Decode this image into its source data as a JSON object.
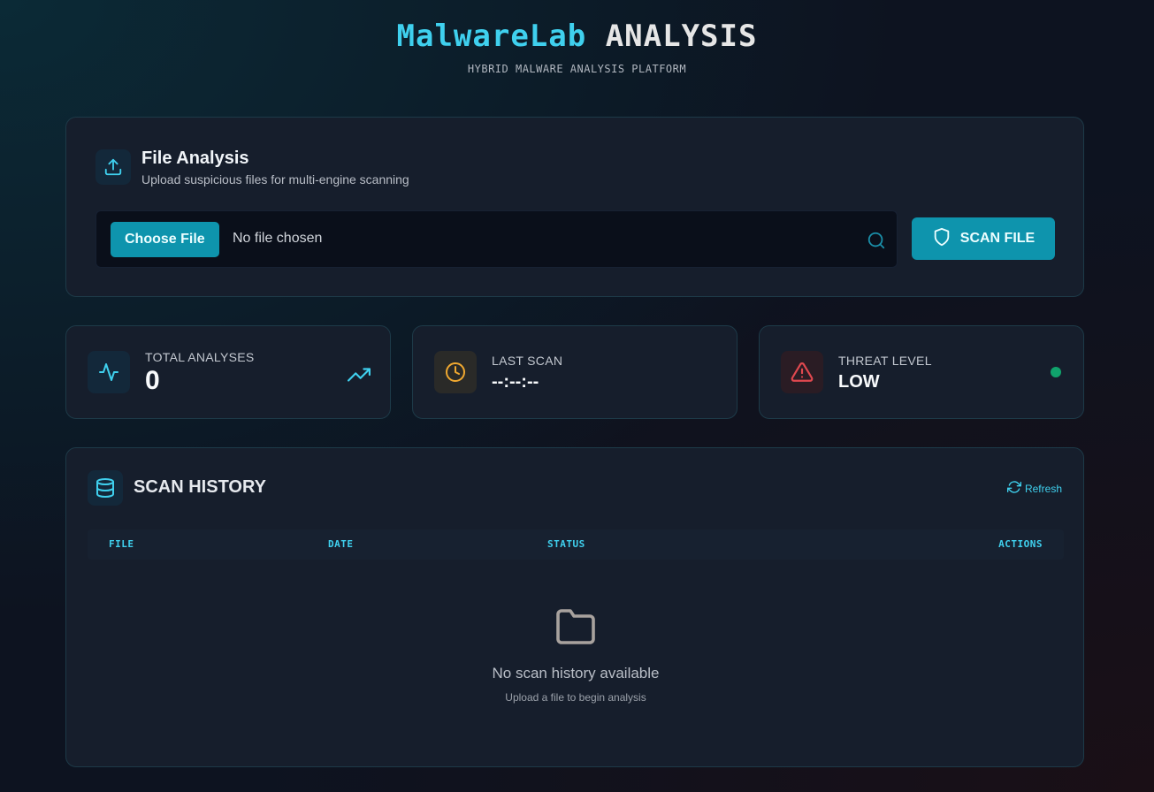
{
  "header": {
    "title_part1": "MalwareLab",
    "title_part2": "ANALYSIS",
    "subtitle": "HYBRID MALWARE ANALYSIS PLATFORM"
  },
  "upload": {
    "title": "File Analysis",
    "subtitle": "Upload suspicious files for multi-engine scanning",
    "choose_label": "Choose File",
    "file_status": "No file chosen",
    "scan_label": "SCAN FILE",
    "icon": "upload-icon"
  },
  "stats": {
    "total": {
      "label": "TOTAL ANALYSES",
      "value": "0",
      "icon": "activity-icon",
      "trend_icon": "trending-up-icon"
    },
    "last_scan": {
      "label": "LAST SCAN",
      "value": "--:--:--",
      "icon": "clock-icon"
    },
    "threat": {
      "label": "THREAT LEVEL",
      "value": "LOW",
      "icon": "alert-triangle-icon",
      "status_color": "#10a36c"
    }
  },
  "history": {
    "title": "SCAN HISTORY",
    "refresh_label": "Refresh",
    "columns": [
      "FILE",
      "DATE",
      "STATUS",
      "ACTIONS"
    ],
    "empty_title": "No scan history available",
    "empty_sub": "Upload a file to begin analysis",
    "icon": "database-icon"
  },
  "colors": {
    "accent": "#3fd0ee",
    "button": "#0e94ad",
    "warning": "#f0a830",
    "danger": "#e0484f",
    "safe": "#10a36c"
  }
}
